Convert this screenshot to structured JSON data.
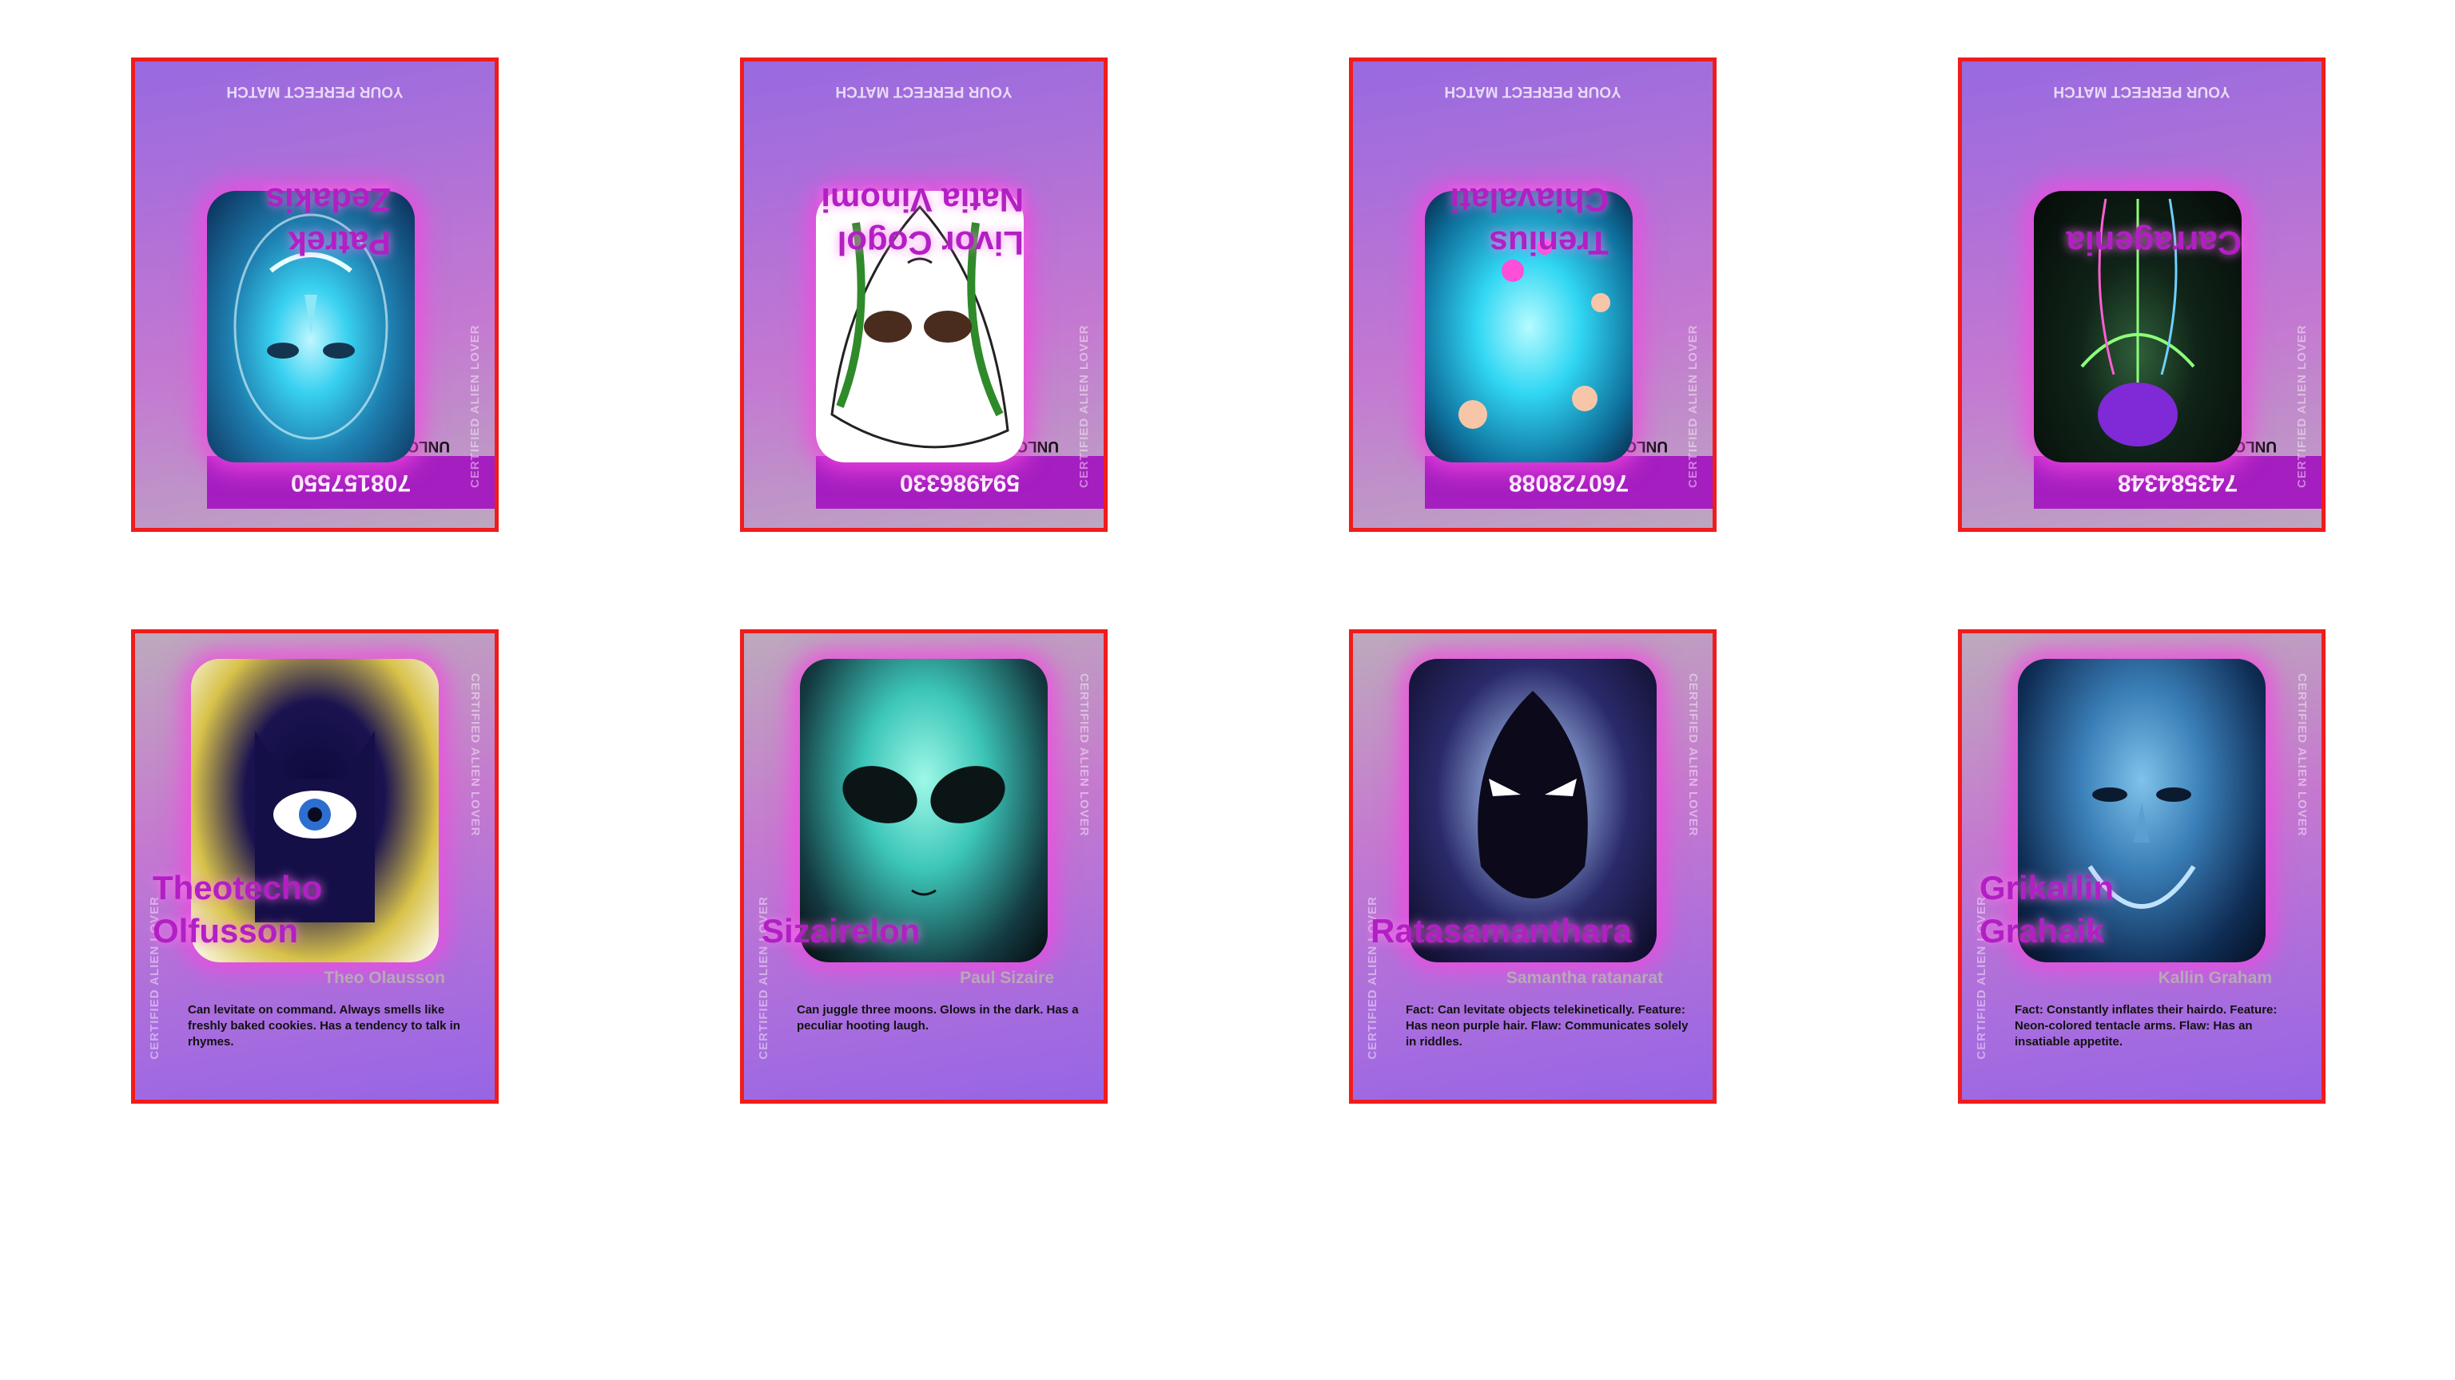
{
  "colors": {
    "border": "#f01c1c",
    "name": "#b21fc4",
    "glow": "#f63ce1",
    "id_bar": "#a51ec0"
  },
  "back_cards": [
    {
      "id": "708157550",
      "unlock": "UNLOCK YOUR LOVE",
      "name_line1": "Patrek",
      "name_line2": "Zedakis",
      "side_text": "CERTIFIED ALIEN LOVER",
      "match": "YOUR PERFECT MATCH"
    },
    {
      "id": "594986330",
      "unlock": "UNLOCK YOUR LOVE",
      "name_line1": "Livor Cogol",
      "name_line2": "Natia Vinomi",
      "side_text": "CERTIFIED ALIEN LOVER",
      "match": "YOUR PERFECT MATCH"
    },
    {
      "id": "760728088",
      "unlock": "UNLOCK YOUR LOVE",
      "name_line1": "Trenius",
      "name_line2": "Chiavalati",
      "side_text": "CERTIFIED ALIEN LOVER",
      "match": "YOUR PERFECT MATCH"
    },
    {
      "id": "743584348",
      "unlock": "UNLOCK YOUR LOVE",
      "name_line1": "",
      "name_line2": "Carragenia",
      "side_text": "CERTIFIED ALIEN LOVER",
      "match": "YOUR PERFECT MATCH"
    }
  ],
  "front_cards": [
    {
      "name_line1": "Theotecho",
      "name_line2": "Olfusson",
      "real_name": "Theo Olausson",
      "side_text": "CERTIFIED ALIEN LOVER",
      "desc": "Can levitate on command. Always smells like freshly baked cookies. Has a tendency to talk in rhymes."
    },
    {
      "name_line1": "",
      "name_line2": "Sizairelon",
      "real_name": "Paul Sizaire",
      "side_text": "CERTIFIED ALIEN LOVER",
      "desc": "Can juggle three moons. Glows in the dark. Has a peculiar hooting laugh."
    },
    {
      "name_line1": "",
      "name_line2": "Ratasamanthara",
      "real_name": "Samantha ratanarat",
      "side_text": "CERTIFIED ALIEN LOVER",
      "desc": "Fact: Can levitate objects telekinetically. Feature: Has neon purple hair. Flaw: Communicates solely in riddles."
    },
    {
      "name_line1": "Grikailin",
      "name_line2": "Grahaik",
      "real_name": "Kallin Graham",
      "side_text": "CERTIFIED ALIEN LOVER",
      "desc": "Fact: Constantly inflates their hairdo. Feature: Neon-colored tentacle arms. Flaw: Has an insatiable appetite."
    }
  ]
}
